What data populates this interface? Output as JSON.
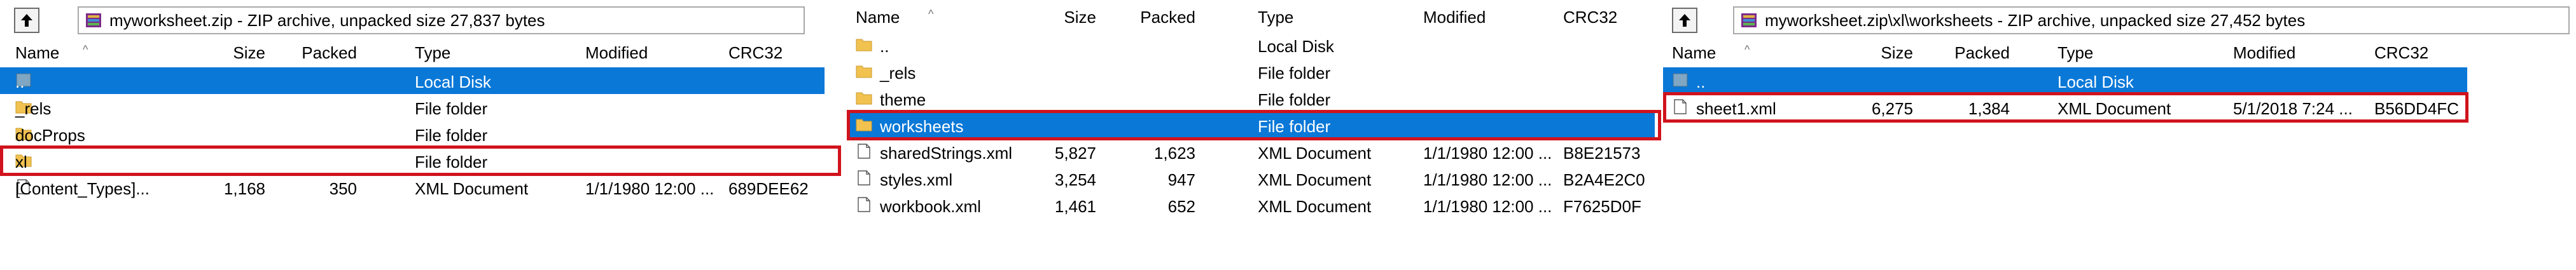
{
  "panels": [
    {
      "address": "myworksheet.zip - ZIP archive, unpacked size 27,837 bytes",
      "columns": {
        "name": "Name",
        "size": "Size",
        "packed": "Packed",
        "type": "Type",
        "modified": "Modified",
        "crc": "CRC32"
      },
      "rows": [
        {
          "icon": "drive-icon",
          "name": "..",
          "size": "",
          "packed": "",
          "type": "Local Disk",
          "modified": "",
          "crc": "",
          "selected": true
        },
        {
          "icon": "folder-icon",
          "name": "_rels",
          "size": "",
          "packed": "",
          "type": "File folder",
          "modified": "",
          "crc": ""
        },
        {
          "icon": "folder-icon",
          "name": "docProps",
          "size": "",
          "packed": "",
          "type": "File folder",
          "modified": "",
          "crc": ""
        },
        {
          "icon": "folder-icon",
          "name": "xl",
          "size": "",
          "packed": "",
          "type": "File folder",
          "modified": "",
          "crc": "",
          "highlighted": true
        },
        {
          "icon": "file-icon",
          "name": "[Content_Types]...",
          "size": "1,168",
          "packed": "350",
          "type": "XML Document",
          "modified": "1/1/1980 12:00 ...",
          "crc": "689DEE62"
        }
      ]
    },
    {
      "address": "",
      "columns": {
        "name": "Name",
        "size": "Size",
        "packed": "Packed",
        "type": "Type",
        "modified": "Modified",
        "crc": "CRC32"
      },
      "rows": [
        {
          "icon": "folder-icon",
          "name": "..",
          "size": "",
          "packed": "",
          "type": "Local Disk",
          "modified": "",
          "crc": ""
        },
        {
          "icon": "folder-icon",
          "name": "_rels",
          "size": "",
          "packed": "",
          "type": "File folder",
          "modified": "",
          "crc": ""
        },
        {
          "icon": "folder-icon",
          "name": "theme",
          "size": "",
          "packed": "",
          "type": "File folder",
          "modified": "",
          "crc": ""
        },
        {
          "icon": "folder-icon",
          "name": "worksheets",
          "size": "",
          "packed": "",
          "type": "File folder",
          "modified": "",
          "crc": "",
          "selected": true,
          "highlighted": true
        },
        {
          "icon": "file-icon",
          "name": "sharedStrings.xml",
          "size": "5,827",
          "packed": "1,623",
          "type": "XML Document",
          "modified": "1/1/1980 12:00 ...",
          "crc": "B8E21573"
        },
        {
          "icon": "file-icon",
          "name": "styles.xml",
          "size": "3,254",
          "packed": "947",
          "type": "XML Document",
          "modified": "1/1/1980 12:00 ...",
          "crc": "B2A4E2C0"
        },
        {
          "icon": "file-icon",
          "name": "workbook.xml",
          "size": "1,461",
          "packed": "652",
          "type": "XML Document",
          "modified": "1/1/1980 12:00 ...",
          "crc": "F7625D0F"
        }
      ]
    },
    {
      "address": "myworksheet.zip\\xl\\worksheets - ZIP archive, unpacked size 27,452 bytes",
      "columns": {
        "name": "Name",
        "size": "Size",
        "packed": "Packed",
        "type": "Type",
        "modified": "Modified",
        "crc": "CRC32"
      },
      "rows": [
        {
          "icon": "drive-icon",
          "name": "..",
          "size": "",
          "packed": "",
          "type": "Local Disk",
          "modified": "",
          "crc": "",
          "selected": true
        },
        {
          "icon": "file-icon",
          "name": "sheet1.xml",
          "size": "6,275",
          "packed": "1,384",
          "type": "XML Document",
          "modified": "5/1/2018 7:24 ...",
          "crc": "B56DD4FC",
          "highlighted": true
        }
      ]
    }
  ],
  "colors": {
    "selection": "#0a78d7",
    "highlight": "#d0131c",
    "folder": "#f2c250"
  }
}
